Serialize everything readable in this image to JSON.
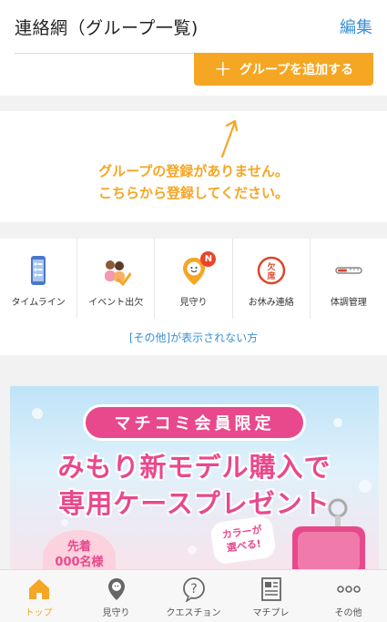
{
  "header": {
    "title": "連絡網（グループ一覧)",
    "edit_label": "編集",
    "add_group_label": "グループを追加する"
  },
  "empty_state": {
    "line1": "グループの登録がありません。",
    "line2": "こちらから登録してください。"
  },
  "features": [
    {
      "label": "タイムライン",
      "icon": "timeline-phone-icon"
    },
    {
      "label": "イベント出欠",
      "icon": "event-attendance-icon"
    },
    {
      "label": "見守り",
      "icon": "watch-over-icon",
      "badge": "N"
    },
    {
      "label": "お休み連絡",
      "icon": "absence-stamp-icon"
    },
    {
      "label": "体調管理",
      "icon": "thermometer-icon"
    }
  ],
  "hidden_link": "[その他]が表示されない方",
  "banner": {
    "pill": "マチコミ会員限定",
    "line1": "みもり新モデル購入で",
    "line2": "専用ケースプレゼント",
    "bubble_line1": "カラーが",
    "bubble_line2": "選べる!",
    "sticker_line1": "先着",
    "sticker_line2": "000名様"
  },
  "tabs": [
    {
      "label": "トップ",
      "icon": "home-icon",
      "active": true
    },
    {
      "label": "見守り",
      "icon": "location-pin-icon"
    },
    {
      "label": "クエスチョン",
      "icon": "question-bubble-icon"
    },
    {
      "label": "マチプレ",
      "icon": "newspaper-icon"
    },
    {
      "label": "その他",
      "icon": "more-dots-icon"
    }
  ],
  "colors": {
    "accent": "#f5a623",
    "link": "#3a8fd6",
    "banner_pink": "#e8498c",
    "badge": "#e8452c"
  }
}
